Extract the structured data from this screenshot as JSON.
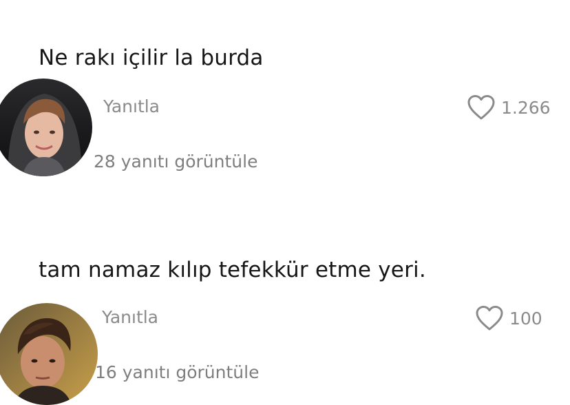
{
  "comments": [
    {
      "text": "Ne rakı içilir la burda",
      "reply_label": "Yanıtla",
      "likes": "1.266",
      "view_replies": "28 yanıtı görüntüle",
      "avatar_icon": "user-avatar-1-icon"
    },
    {
      "text": "tam namaz kılıp tefekkür etme yeri.",
      "reply_label": "Yanıtla",
      "likes": "100",
      "view_replies": "16 yanıtı görüntüle",
      "avatar_icon": "user-avatar-2-icon"
    }
  ],
  "colors": {
    "text": "#161616",
    "muted": "#8a8a8a",
    "background": "#ffffff"
  }
}
